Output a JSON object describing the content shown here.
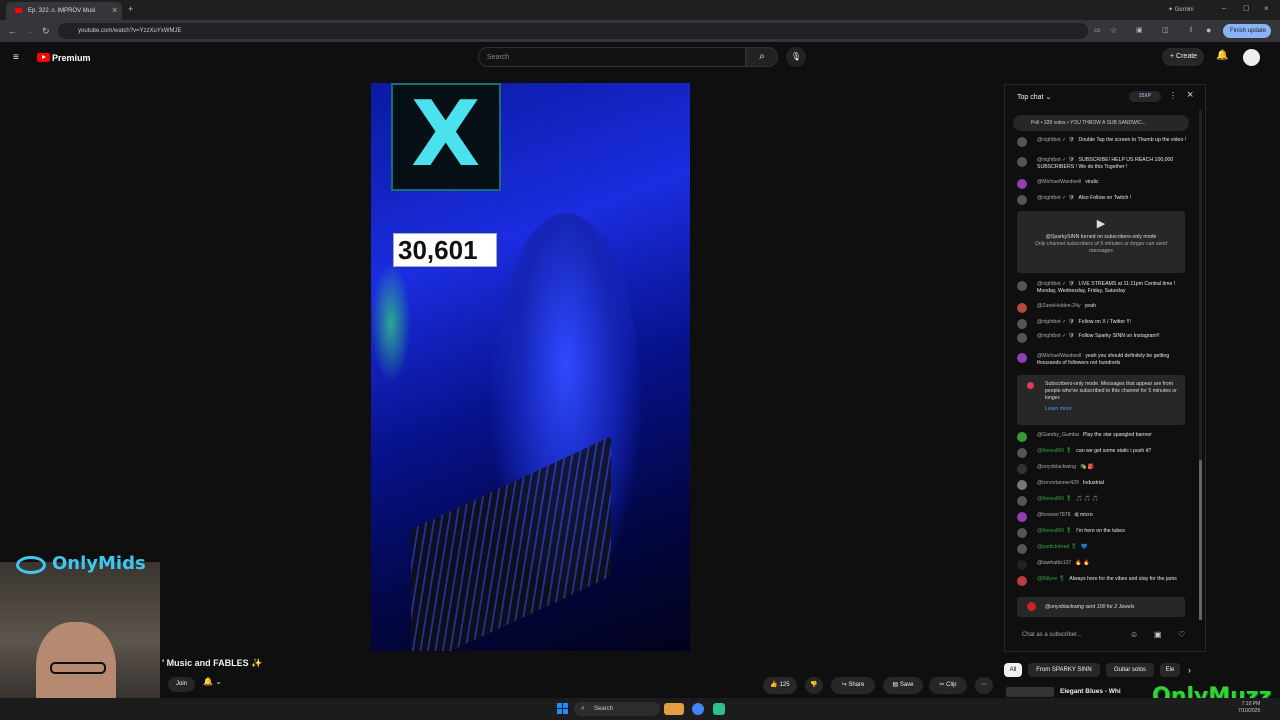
{
  "browser": {
    "tab_title": "Ep. 322 ⚠ IMPROV Musi",
    "new_tab": "+",
    "profile": "Gemini",
    "url": "youtube.com/watch?v=YzzXuYxWMJE",
    "update_label": "Finish update"
  },
  "header": {
    "brand": "Premium",
    "search_placeholder": "Search",
    "create_label": "Create"
  },
  "video": {
    "counter": "30,601",
    "sign_letter": "X"
  },
  "overlay": {
    "brand_left": "OnlyMids",
    "brand_right": "OnlyMuzz",
    "title": "' Music and FABLES ✨",
    "join_label": "Join"
  },
  "actions": {
    "likes": "125",
    "share": "Share",
    "save": "Save",
    "clip": "Clip"
  },
  "chat": {
    "header": "Top chat",
    "xp": "25XP",
    "poll": "Poll • 328 votes • YOU THROW A SUB SANDWIC...",
    "messages": [
      {
        "author": "@nightbot ✓ 🛡",
        "text": "Double Tap the screen to Thumb up the video !",
        "color": "#555"
      },
      {
        "author": "@nightbot ✓ 🛡",
        "text": "SUBSCRIBE! HELP US REACH 100,000 SUBSCRIBERS ! We do this Together !",
        "color": "#555"
      },
      {
        "author": "@MichaelWardwell",
        "text": "viralic",
        "color": "#8e3fb5"
      },
      {
        "author": "@nightbot ✓ 🛡",
        "text": "Also Follow on Twitch !",
        "color": "#555"
      }
    ],
    "subs_notice": "@SparkySINN turned on subscribers-only mode",
    "subs_notice_sub": "Only channel subscribers of 5 minutes or longer can send messages",
    "messages2": [
      {
        "author": "@nightbot ✓ 🛡",
        "text": "LIVE STREAMS at 11:11pm Central time ! Monday, Wednesday, Friday, Saturday",
        "color": "#555"
      },
      {
        "author": "@ZaneHolden-24y",
        "text": "yeah",
        "color": "#b54a3f"
      },
      {
        "author": "@nightbot ✓ 🛡",
        "text": "Follow on X / Twitter !!!",
        "color": "#555"
      },
      {
        "author": "@nightbot ✓ 🛡",
        "text": "Follow Sparky SINN on Instagram!!",
        "color": "#555"
      },
      {
        "author": "@MichaelWardwell",
        "text": "yeah you should definitely be getting thousands of followers not hundreds",
        "color": "#8e3fb5"
      }
    ],
    "mode_notice": "Subscribers-only mode. Messages that appear are from people who've subscribed to this channel for 5 minutes or longer.",
    "learn_more": "Learn more",
    "messages3": [
      {
        "author": "@Gamby_Gumba",
        "text": "Play the star spangled banner",
        "color": "#3a9a3a"
      },
      {
        "author": "@firewall56 🎖",
        "text": "can we get some static i push it?",
        "color": "#555"
      },
      {
        "author": "@onyxblackwing",
        "text": "🎭 🎒",
        "color": "#333"
      },
      {
        "author": "@trevortanner429",
        "text": "Industrial",
        "color": "#777"
      },
      {
        "author": "@firewall56 🎖",
        "text": "🎵 🎵 🎵",
        "color": "#555"
      },
      {
        "author": "@bowser7878",
        "text": "dj micro",
        "color": "#8e3fb5"
      },
      {
        "author": "@firewall56 🎖",
        "text": "I'm here on the tubes",
        "color": "#555"
      },
      {
        "author": "@particlebrad 🎖",
        "text": "💙",
        "color": "#555"
      },
      {
        "author": "@tawhattis137",
        "text": "🔥 🔥",
        "color": "#333"
      },
      {
        "author": "@Billyve 🎖",
        "text": "Always here for the vibes and stay for the jams",
        "color": "#b53f3f"
      }
    ],
    "super_chat": "@onyxblackwing sent 100 for 2 Jewels",
    "input_placeholder": "Chat as a subscriber..."
  },
  "recs": {
    "chips": [
      "All",
      "From SPARKY SINN",
      "Guitar solos",
      "Ele"
    ],
    "item_title": "Elegant Blues - Whi"
  },
  "taskbar": {
    "search": "Search",
    "time": "7:10 PM",
    "date": "7/10/2025"
  }
}
